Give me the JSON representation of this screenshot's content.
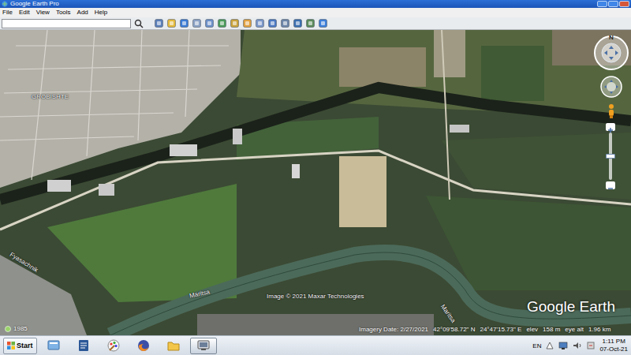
{
  "window": {
    "title": "Google Earth Pro"
  },
  "menu": [
    "File",
    "Edit",
    "View",
    "Tools",
    "Add",
    "Help"
  ],
  "map": {
    "labels": [
      {
        "text": "GROBISHTE"
      },
      {
        "text": "Fyasachnik"
      },
      {
        "text": "Maritsa"
      },
      {
        "text": "Maritsa"
      }
    ],
    "copyright": "Image © 2021 Maxar Technologies",
    "logo": "Google Earth",
    "history_year": "1985"
  },
  "navigation": {
    "north": "N",
    "zoom": {
      "level": 0.5
    }
  },
  "status_bar": {
    "imagery_date": "Imagery Date: 2/27/2021",
    "latitude": "42°09'58.72\" N",
    "longitude": "24°47'15.73\" E",
    "elev_label": "elev",
    "elev": "158 m",
    "eye_alt_label": "eye alt",
    "eye_alt": "1.96 km"
  },
  "taskbar": {
    "start": "Start",
    "apps": [
      {
        "kind": "explorer",
        "selected": false
      },
      {
        "kind": "word",
        "selected": false
      },
      {
        "kind": "paint",
        "selected": false
      },
      {
        "kind": "firefox",
        "selected": false
      },
      {
        "kind": "folder",
        "selected": false
      },
      {
        "kind": "earth",
        "selected": true
      }
    ],
    "language": "EN",
    "time": "1:11 PM",
    "date": "07-Oct-21"
  }
}
